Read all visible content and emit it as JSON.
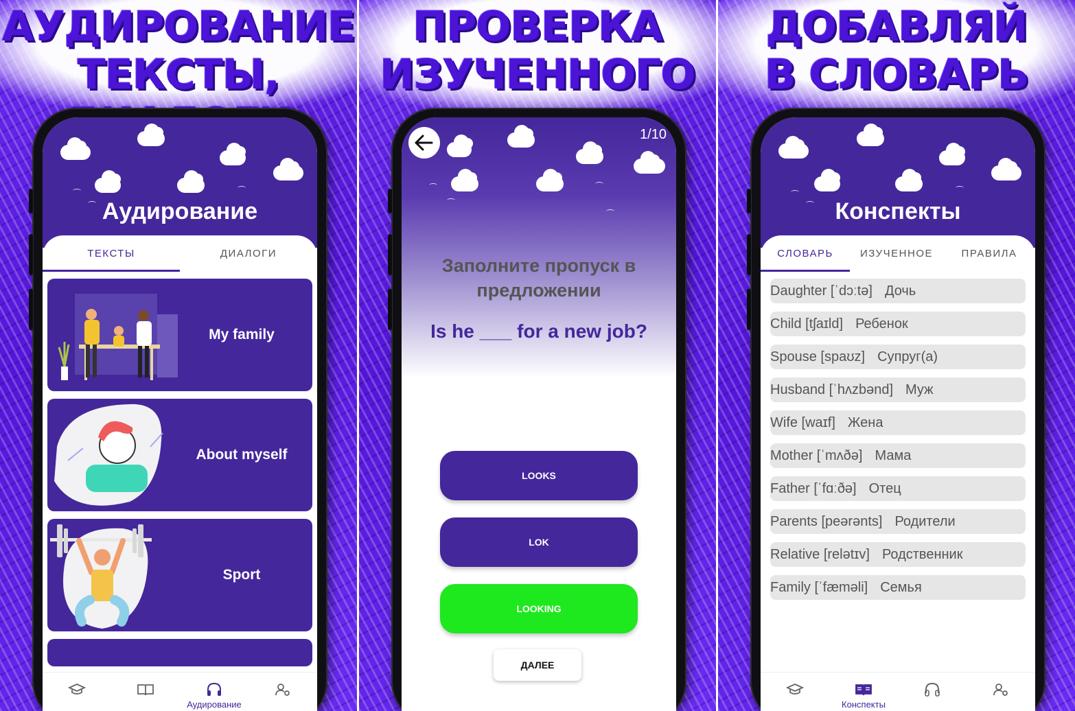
{
  "panels": [
    {
      "banner": [
        "АУДИРОВАНИЕ",
        "ТЕКСТЫ, ДИАЛОГИ"
      ],
      "screen": {
        "title": "Аудирование",
        "tabs": [
          {
            "label": "ТЕКСТЫ",
            "active": true
          },
          {
            "label": "ДИАЛОГИ",
            "active": false
          }
        ],
        "cards": [
          {
            "title": "My family"
          },
          {
            "title": "About myself"
          },
          {
            "title": "Sport"
          }
        ],
        "nav": [
          {
            "icon": "graduation-cap-icon",
            "label": ""
          },
          {
            "icon": "book-icon",
            "label": ""
          },
          {
            "icon": "headphones-icon",
            "label": "Аудирование",
            "active": true
          },
          {
            "icon": "user-settings-icon",
            "label": ""
          }
        ]
      }
    },
    {
      "banner": [
        "ПРОВЕРКА",
        "ИЗУЧЕННОГО"
      ],
      "screen": {
        "counter": "1/10",
        "instruction": "Заполните пропуск в предложении",
        "question": "Is he ___ for a new job?",
        "answers": [
          {
            "label": "LOOKS",
            "correct": false
          },
          {
            "label": "LOK",
            "correct": false
          },
          {
            "label": "LOOKING",
            "correct": true
          }
        ],
        "next_label": "ДАЛЕЕ"
      }
    },
    {
      "banner": [
        "ДОБАВЛЯЙ",
        "В СЛОВАРЬ"
      ],
      "screen": {
        "title": "Конспекты",
        "tabs": [
          {
            "label": "СЛОВАРЬ",
            "active": true
          },
          {
            "label": "ИЗУЧЕННОЕ",
            "active": false
          },
          {
            "label": "ПРАВИЛА",
            "active": false
          }
        ],
        "words": [
          {
            "word": "Daughter [ˈdɔːtə]",
            "translation": "Дочь"
          },
          {
            "word": "Child [tʃaɪld]",
            "translation": "Ребенок"
          },
          {
            "word": "Spouse [spaʊz]",
            "translation": "Супруг(а)"
          },
          {
            "word": "Husband [ˈhʌzbənd]",
            "translation": "Муж"
          },
          {
            "word": "Wife [waɪf]",
            "translation": "Жена"
          },
          {
            "word": "Mother [ˈmʌðə]",
            "translation": "Мама"
          },
          {
            "word": "Father [ˈfɑːðə]",
            "translation": "Отец"
          },
          {
            "word": "Parents [peərənts]",
            "translation": "Родители"
          },
          {
            "word": "Relative [relətɪv]",
            "translation": "Родственник"
          },
          {
            "word": "Family [ˈfæməli]",
            "translation": "Семья"
          }
        ],
        "nav": [
          {
            "icon": "graduation-cap-icon",
            "label": ""
          },
          {
            "icon": "book-icon",
            "label": "Конспекты",
            "active": true
          },
          {
            "icon": "headphones-icon",
            "label": ""
          },
          {
            "icon": "user-settings-icon",
            "label": ""
          }
        ]
      }
    }
  ],
  "colors": {
    "primary": "#44279b",
    "correct": "#1ee81e",
    "banner_text": "#4b14d6",
    "background": "#5316d8",
    "row_bg": "#e6e6e6"
  }
}
